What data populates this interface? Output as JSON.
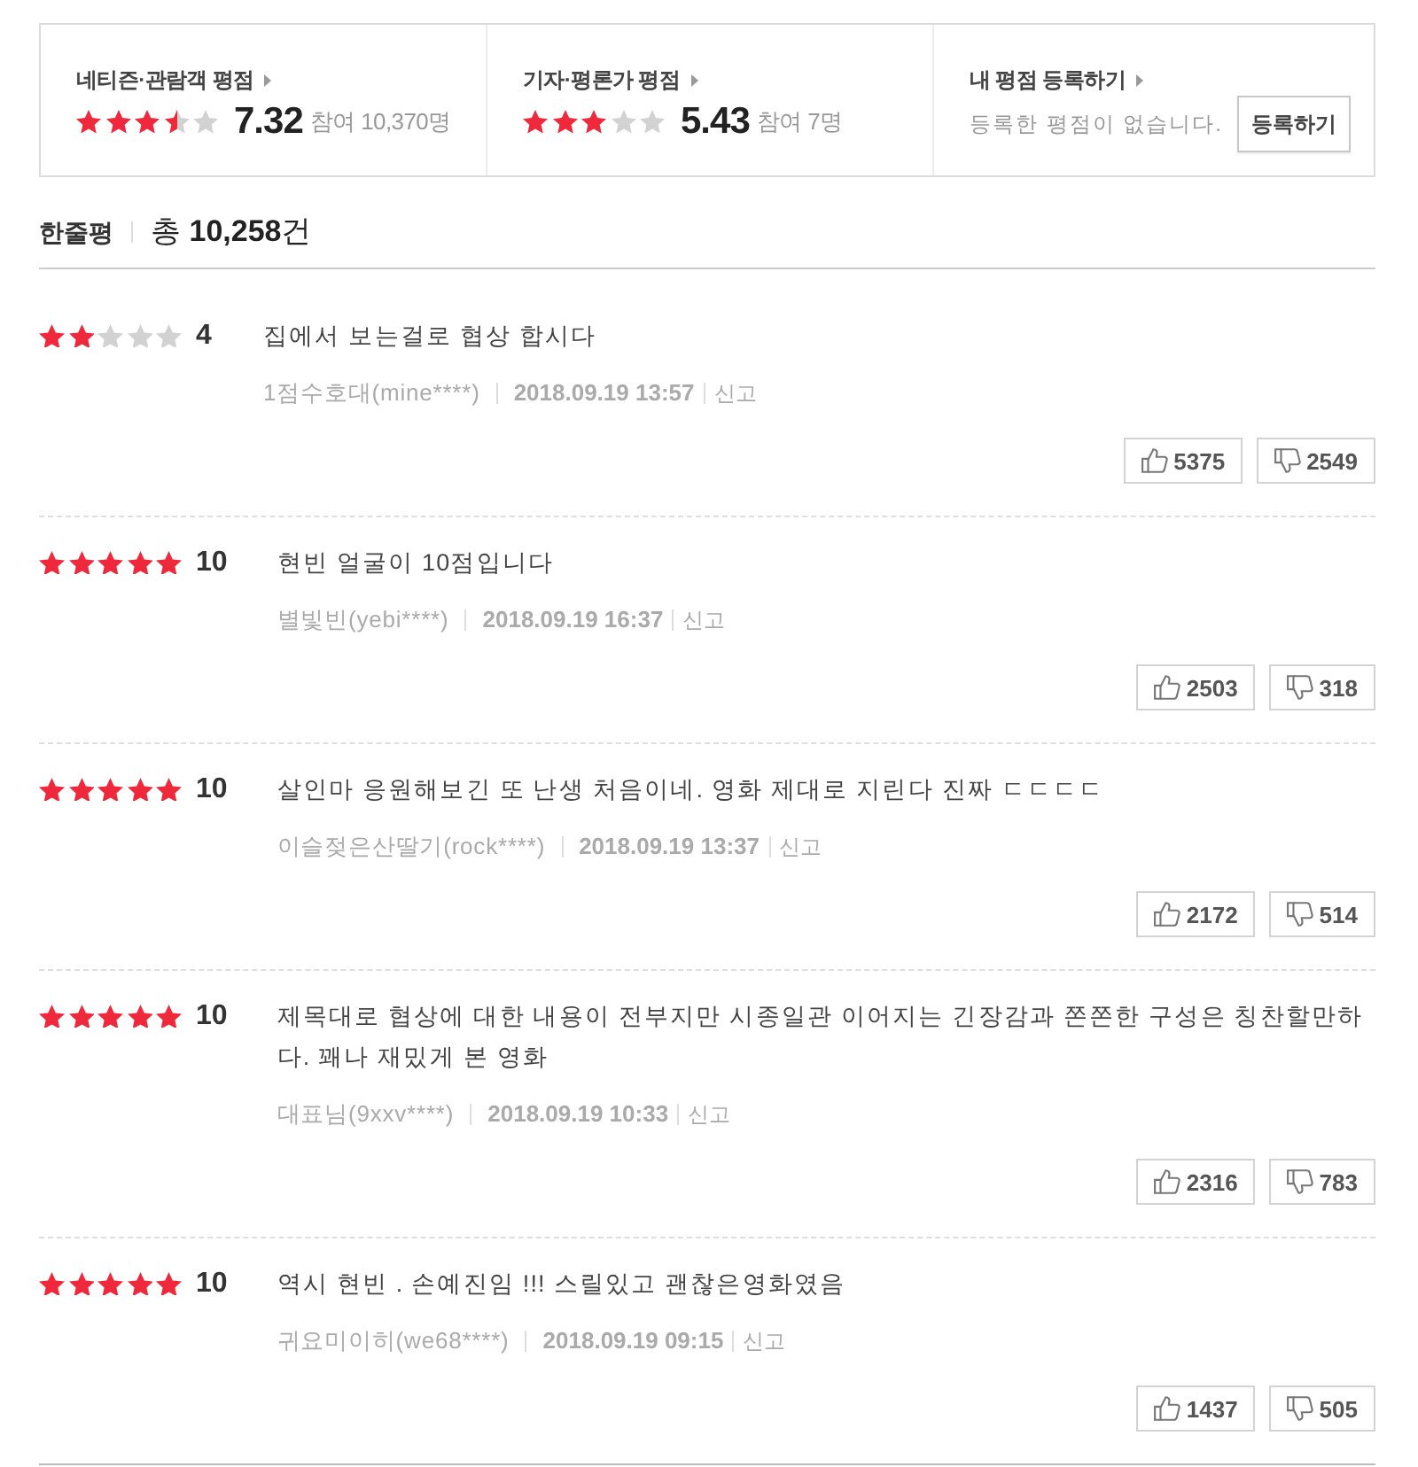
{
  "ratings": [
    {
      "title": "네티즌·관람객 평점",
      "stars": 3.5,
      "score": "7.32",
      "participants": "참여 10,370명"
    },
    {
      "title": "기자·평론가 평점",
      "stars": 3,
      "score": "5.43",
      "participants": "참여 7명"
    }
  ],
  "my_rating": {
    "title": "내 평점 등록하기",
    "message": "등록한 평점이 없습니다.",
    "button": "등록하기"
  },
  "reviews_header": {
    "title": "한줄평",
    "total": "총 **10,258**건"
  },
  "reviews": [
    {
      "stars": 2,
      "score": "4",
      "text": "집에서 보는걸로 협상 합시다",
      "author": "1점수호대(mine****)",
      "date": "2018.09.19 13:57",
      "report": "신고",
      "likes": "5375",
      "dislikes": "2549"
    },
    {
      "stars": 5,
      "score": "10",
      "text": "현빈 얼굴이 10점입니다",
      "author": "별빛빈(yebi****)",
      "date": "2018.09.19 16:37",
      "report": "신고",
      "likes": "2503",
      "dislikes": "318"
    },
    {
      "stars": 5,
      "score": "10",
      "text": "살인마 응원해보긴 또 난생 처음이네. 영화 제대로 지린다 진짜 ㄷㄷㄷㄷ",
      "author": "이슬젖은산딸기(rock****)",
      "date": "2018.09.19 13:37",
      "report": "신고",
      "likes": "2172",
      "dislikes": "514"
    },
    {
      "stars": 5,
      "score": "10",
      "text": "제목대로 협상에 대한 내용이 전부지만 시종일관 이어지는 긴장감과 쫀쫀한 구성은 칭찬할만하다. 꽤나 재밌게 본 영화",
      "author": "대표님(9xxv****)",
      "date": "2018.09.19 10:33",
      "report": "신고",
      "likes": "2316",
      "dislikes": "783"
    },
    {
      "stars": 5,
      "score": "10",
      "text": "역시 현빈 . 손예진임 !!! 스릴있고 괜찮은영화였음",
      "author": "귀요미이히(we68****)",
      "date": "2018.09.19 09:15",
      "report": "신고",
      "likes": "1437",
      "dislikes": "505"
    }
  ]
}
